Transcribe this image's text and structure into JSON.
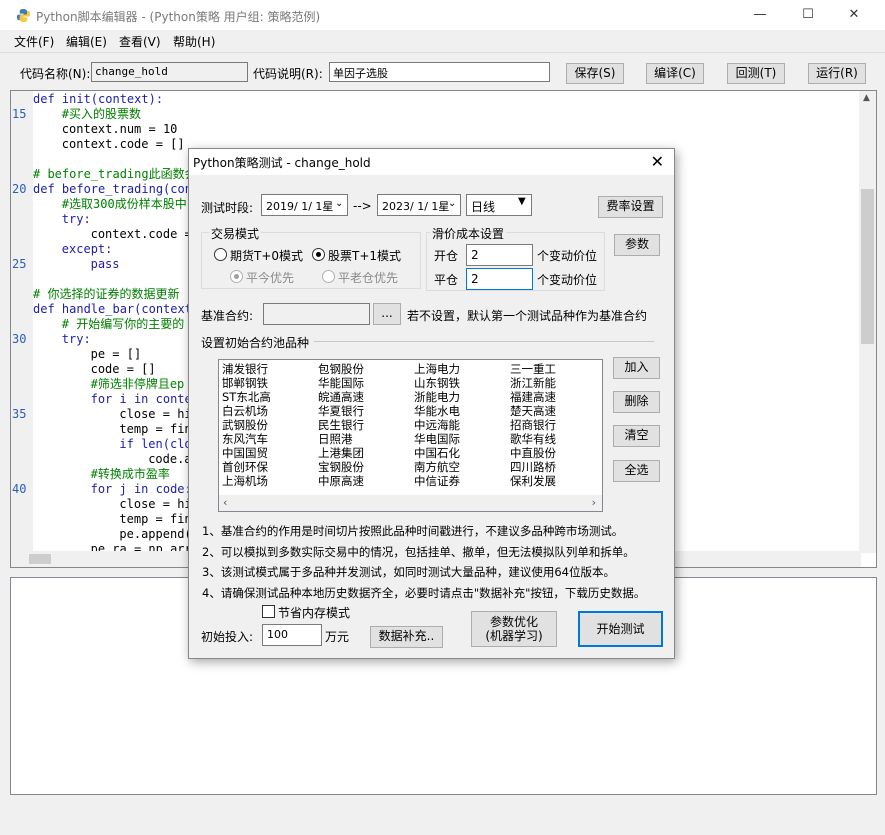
{
  "window": {
    "title": "Python脚本编辑器 - (Python策略 用户组: 策略范例)",
    "minimize": "—",
    "maximize": "☐",
    "close": "✕"
  },
  "menu": [
    "文件(F)",
    "编辑(E)",
    "查看(V)",
    "帮助(H)"
  ],
  "toolbar": {
    "code_name_label": "代码名称(N):",
    "code_name_value": "change_hold",
    "code_desc_label": "代码说明(R):",
    "code_desc_value": "单因子选股",
    "save": "保存(S)",
    "compile": "编译(C)",
    "backtest": "回测(T)",
    "run": "运行(R)"
  },
  "editor": {
    "line_numbers": [
      "15",
      "20",
      "25",
      "30",
      "35",
      "40"
    ],
    "lines": [
      {
        "indent": "",
        "text": "def init(context):",
        "type": "kw"
      },
      {
        "indent": "    ",
        "text": "#买入的股票数",
        "type": "cm"
      },
      {
        "indent": "    ",
        "text": "context.num = 10",
        "type": "code"
      },
      {
        "indent": "    ",
        "text": "context.code = []",
        "type": "code"
      },
      {
        "indent": "",
        "text": "",
        "type": "code"
      },
      {
        "indent": "",
        "text": "# before_trading此函数会",
        "type": "cm"
      },
      {
        "indent": "",
        "text": "def before_trading(cont",
        "type": "kw"
      },
      {
        "indent": "    ",
        "text": "#选取300成份样本股中",
        "type": "cm"
      },
      {
        "indent": "    ",
        "text": "try:",
        "type": "kw"
      },
      {
        "indent": "        ",
        "text": "context.code = ",
        "type": "code"
      },
      {
        "indent": "    ",
        "text": "except:",
        "type": "kw"
      },
      {
        "indent": "        ",
        "text": "pass",
        "type": "kw"
      },
      {
        "indent": "",
        "text": "",
        "type": "code"
      },
      {
        "indent": "",
        "text": "# 你选择的证券的数据更新",
        "type": "cm"
      },
      {
        "indent": "",
        "text": "def handle_bar(context,",
        "type": "kw"
      },
      {
        "indent": "    ",
        "text": "# 开始编写你的主要的",
        "type": "cm"
      },
      {
        "indent": "    ",
        "text": "try:",
        "type": "kw"
      },
      {
        "indent": "        ",
        "text": "pe = []",
        "type": "code"
      },
      {
        "indent": "        ",
        "text": "code = []",
        "type": "code"
      },
      {
        "indent": "        ",
        "text": "#筛选非停牌且ep",
        "type": "cm"
      },
      {
        "indent": "        ",
        "text": "for i in contex",
        "type": "kw"
      },
      {
        "indent": "            ",
        "text": "close = his",
        "type": "code"
      },
      {
        "indent": "            ",
        "text": "temp = fin",
        "type": "code"
      },
      {
        "indent": "            ",
        "text": "if len(clo",
        "type": "kw"
      },
      {
        "indent": "                ",
        "text": "code.ap",
        "type": "code"
      },
      {
        "indent": "        ",
        "text": "#转换成市盈率",
        "type": "cm"
      },
      {
        "indent": "        ",
        "text": "for j in code:",
        "type": "kw"
      },
      {
        "indent": "            ",
        "text": "close = his",
        "type": "code"
      },
      {
        "indent": "            ",
        "text": "temp = fin",
        "type": "code"
      },
      {
        "indent": "            ",
        "text": "pe.append((",
        "type": "code"
      },
      {
        "indent": "        ",
        "text": "pe_ra = np.arra",
        "type": "code"
      }
    ]
  },
  "dialog": {
    "title": "Python策略测试 - change_hold",
    "close": "✕",
    "period_label": "测试时段:",
    "start_date": "2019/ 1/ 1星",
    "arrow": "-->",
    "end_date": "2023/ 1/ 1星",
    "frequency": "日线",
    "fee_button": "费率设置",
    "trade_mode_title": "交易模式",
    "mode_futures": "期货T+0模式",
    "mode_stock": "股票T+1模式",
    "opt_today_first": "平今优先",
    "opt_old_first": "平老仓优先",
    "slippage_title": "滑价成本设置",
    "open_label": "开仓",
    "open_value": "2",
    "close_label": "平仓",
    "close_value": "2",
    "unit_label": "个变动价位",
    "params_button": "参数",
    "benchmark_label": "基准合约:",
    "benchmark_value": "",
    "browse_button": "...",
    "benchmark_hint": "若不设置，默认第一个测试品种作为基准合约",
    "initial_section": "设置初始合约池品种",
    "stocks": [
      [
        "浦发银行",
        "包钢股份",
        "上海电力",
        "三一重工"
      ],
      [
        "邯郸钢铁",
        "华能国际",
        "山东钢铁",
        "浙江新能"
      ],
      [
        "ST东北高",
        "皖通高速",
        "浙能电力",
        "福建高速"
      ],
      [
        "白云机场",
        "华夏银行",
        "华能水电",
        "楚天高速"
      ],
      [
        "武钢股份",
        "民生银行",
        "中远海能",
        "招商银行"
      ],
      [
        "东风汽车",
        "日照港",
        "华电国际",
        "歌华有线"
      ],
      [
        "中国国贸",
        "上港集团",
        "中国石化",
        "中直股份"
      ],
      [
        "首创环保",
        "宝钢股份",
        "南方航空",
        "四川路桥"
      ],
      [
        "上海机场",
        "中原高速",
        "中信证券",
        "保利发展"
      ]
    ],
    "add_button": "加入",
    "delete_button": "删除",
    "clear_button": "清空",
    "select_all_button": "全选",
    "notes": [
      "1、基准合约的作用是时间切片按照此品种时间戳进行，不建议多品种跨市场测试。",
      "2、可以模拟到多数实际交易中的情况，包括挂单、撤单，但无法模拟队列单和拆单。",
      "3、该测试模式属于多品种并发测试，如同时测试大量品种，建议使用64位版本。",
      "4、请确保测试品种本地历史数据齐全，必要时请点击\"数据补充\"按钮，下载历史数据。"
    ],
    "memory_mode": "节省内存模式",
    "initial_invest_label": "初始投入:",
    "initial_invest_value": "100",
    "initial_invest_unit": "万元",
    "data_supplement_button": "数据补充..",
    "param_opt_line1": "参数优化",
    "param_opt_line2": "(机器学习)",
    "start_test_button": "开始测试"
  },
  "colors": {
    "keyword": "#1d1daf",
    "comment": "#008000",
    "line_number": "#2a5fb8"
  }
}
